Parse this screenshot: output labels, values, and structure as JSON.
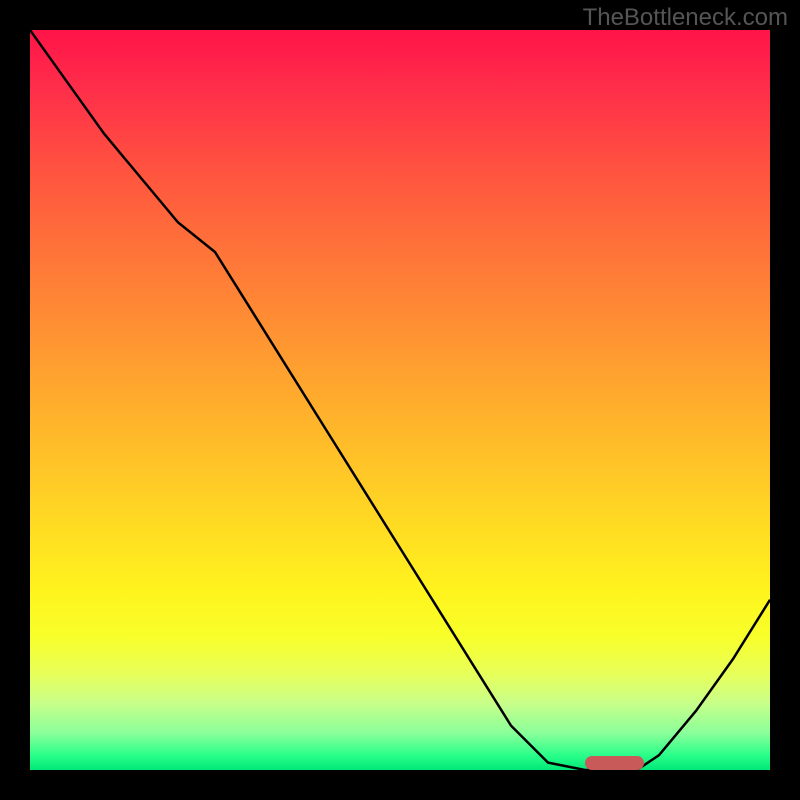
{
  "watermark": "TheBottleneck.com",
  "chart_data": {
    "type": "line",
    "title": "",
    "xlabel": "",
    "ylabel": "",
    "x": [
      0,
      5,
      10,
      15,
      20,
      25,
      30,
      35,
      40,
      45,
      50,
      55,
      60,
      65,
      70,
      75,
      78,
      82,
      85,
      90,
      95,
      100
    ],
    "y": [
      100,
      93,
      86,
      80,
      74,
      70,
      62,
      54,
      46,
      38,
      30,
      22,
      14,
      6,
      1,
      0,
      0,
      0,
      2,
      8,
      15,
      23
    ],
    "xlim": [
      0,
      100
    ],
    "ylim": [
      0,
      100
    ],
    "marker_range_x": [
      75,
      83
    ],
    "gradient_colors": {
      "top": "#ff1448",
      "mid_upper": "#ff8a34",
      "mid": "#ffde22",
      "mid_lower": "#f8ff2a",
      "bottom": "#00e878"
    }
  }
}
